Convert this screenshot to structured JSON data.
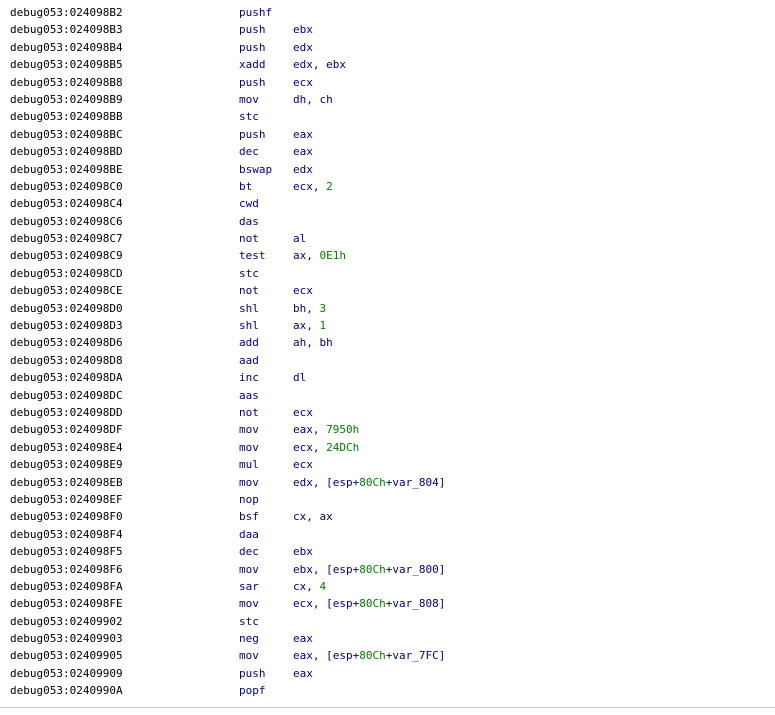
{
  "colors": {
    "address": "#000000",
    "instruction": "#000080",
    "number": "#008000"
  },
  "rows": [
    {
      "addr": "debug053:024098B2",
      "mnem": "pushf",
      "ops": []
    },
    {
      "addr": "debug053:024098B3",
      "mnem": "push",
      "ops": [
        {
          "t": "ebx"
        }
      ]
    },
    {
      "addr": "debug053:024098B4",
      "mnem": "push",
      "ops": [
        {
          "t": "edx"
        }
      ]
    },
    {
      "addr": "debug053:024098B5",
      "mnem": "xadd",
      "ops": [
        {
          "t": "edx, ebx"
        }
      ]
    },
    {
      "addr": "debug053:024098B8",
      "mnem": "push",
      "ops": [
        {
          "t": "ecx"
        }
      ]
    },
    {
      "addr": "debug053:024098B9",
      "mnem": "mov",
      "ops": [
        {
          "t": "dh, ch"
        }
      ]
    },
    {
      "addr": "debug053:024098BB",
      "mnem": "stc",
      "ops": []
    },
    {
      "addr": "debug053:024098BC",
      "mnem": "push",
      "ops": [
        {
          "t": "eax"
        }
      ]
    },
    {
      "addr": "debug053:024098BD",
      "mnem": "dec",
      "ops": [
        {
          "t": "eax"
        }
      ]
    },
    {
      "addr": "debug053:024098BE",
      "mnem": "bswap",
      "ops": [
        {
          "t": "edx"
        }
      ]
    },
    {
      "addr": "debug053:024098C0",
      "mnem": "bt",
      "ops": [
        {
          "t": "ecx, "
        },
        {
          "t": "2",
          "num": true
        }
      ]
    },
    {
      "addr": "debug053:024098C4",
      "mnem": "cwd",
      "ops": []
    },
    {
      "addr": "debug053:024098C6",
      "mnem": "das",
      "ops": []
    },
    {
      "addr": "debug053:024098C7",
      "mnem": "not",
      "ops": [
        {
          "t": "al"
        }
      ]
    },
    {
      "addr": "debug053:024098C9",
      "mnem": "test",
      "ops": [
        {
          "t": "ax, "
        },
        {
          "t": "0E1h",
          "num": true
        }
      ]
    },
    {
      "addr": "debug053:024098CD",
      "mnem": "stc",
      "ops": []
    },
    {
      "addr": "debug053:024098CE",
      "mnem": "not",
      "ops": [
        {
          "t": "ecx"
        }
      ]
    },
    {
      "addr": "debug053:024098D0",
      "mnem": "shl",
      "ops": [
        {
          "t": "bh, "
        },
        {
          "t": "3",
          "num": true
        }
      ]
    },
    {
      "addr": "debug053:024098D3",
      "mnem": "shl",
      "ops": [
        {
          "t": "ax, "
        },
        {
          "t": "1",
          "num": true
        }
      ]
    },
    {
      "addr": "debug053:024098D6",
      "mnem": "add",
      "ops": [
        {
          "t": "ah, bh"
        }
      ]
    },
    {
      "addr": "debug053:024098D8",
      "mnem": "aad",
      "ops": []
    },
    {
      "addr": "debug053:024098DA",
      "mnem": "inc",
      "ops": [
        {
          "t": "dl"
        }
      ]
    },
    {
      "addr": "debug053:024098DC",
      "mnem": "aas",
      "ops": []
    },
    {
      "addr": "debug053:024098DD",
      "mnem": "not",
      "ops": [
        {
          "t": "ecx"
        }
      ]
    },
    {
      "addr": "debug053:024098DF",
      "mnem": "mov",
      "ops": [
        {
          "t": "eax, "
        },
        {
          "t": "7950h",
          "num": true
        }
      ]
    },
    {
      "addr": "debug053:024098E4",
      "mnem": "mov",
      "ops": [
        {
          "t": "ecx, "
        },
        {
          "t": "24DCh",
          "num": true
        }
      ]
    },
    {
      "addr": "debug053:024098E9",
      "mnem": "mul",
      "ops": [
        {
          "t": "ecx"
        }
      ]
    },
    {
      "addr": "debug053:024098EB",
      "mnem": "mov",
      "ops": [
        {
          "t": "edx, [esp+"
        },
        {
          "t": "80Ch",
          "num": true
        },
        {
          "t": "+var_804]"
        }
      ]
    },
    {
      "addr": "debug053:024098EF",
      "mnem": "nop",
      "ops": []
    },
    {
      "addr": "debug053:024098F0",
      "mnem": "bsf",
      "ops": [
        {
          "t": "cx, ax"
        }
      ]
    },
    {
      "addr": "debug053:024098F4",
      "mnem": "daa",
      "ops": []
    },
    {
      "addr": "debug053:024098F5",
      "mnem": "dec",
      "ops": [
        {
          "t": "ebx"
        }
      ]
    },
    {
      "addr": "debug053:024098F6",
      "mnem": "mov",
      "ops": [
        {
          "t": "ebx, [esp+"
        },
        {
          "t": "80Ch",
          "num": true
        },
        {
          "t": "+var_800]"
        }
      ]
    },
    {
      "addr": "debug053:024098FA",
      "mnem": "sar",
      "ops": [
        {
          "t": "cx, "
        },
        {
          "t": "4",
          "num": true
        }
      ]
    },
    {
      "addr": "debug053:024098FE",
      "mnem": "mov",
      "ops": [
        {
          "t": "ecx, [esp+"
        },
        {
          "t": "80Ch",
          "num": true
        },
        {
          "t": "+var_808]"
        }
      ]
    },
    {
      "addr": "debug053:02409902",
      "mnem": "stc",
      "ops": []
    },
    {
      "addr": "debug053:02409903",
      "mnem": "neg",
      "ops": [
        {
          "t": "eax"
        }
      ]
    },
    {
      "addr": "debug053:02409905",
      "mnem": "mov",
      "ops": [
        {
          "t": "eax, [esp+"
        },
        {
          "t": "80Ch",
          "num": true
        },
        {
          "t": "+var_7FC]"
        }
      ]
    },
    {
      "addr": "debug053:02409909",
      "mnem": "push",
      "ops": [
        {
          "t": "eax"
        }
      ]
    },
    {
      "addr": "debug053:0240990A",
      "mnem": "popf",
      "ops": []
    }
  ]
}
